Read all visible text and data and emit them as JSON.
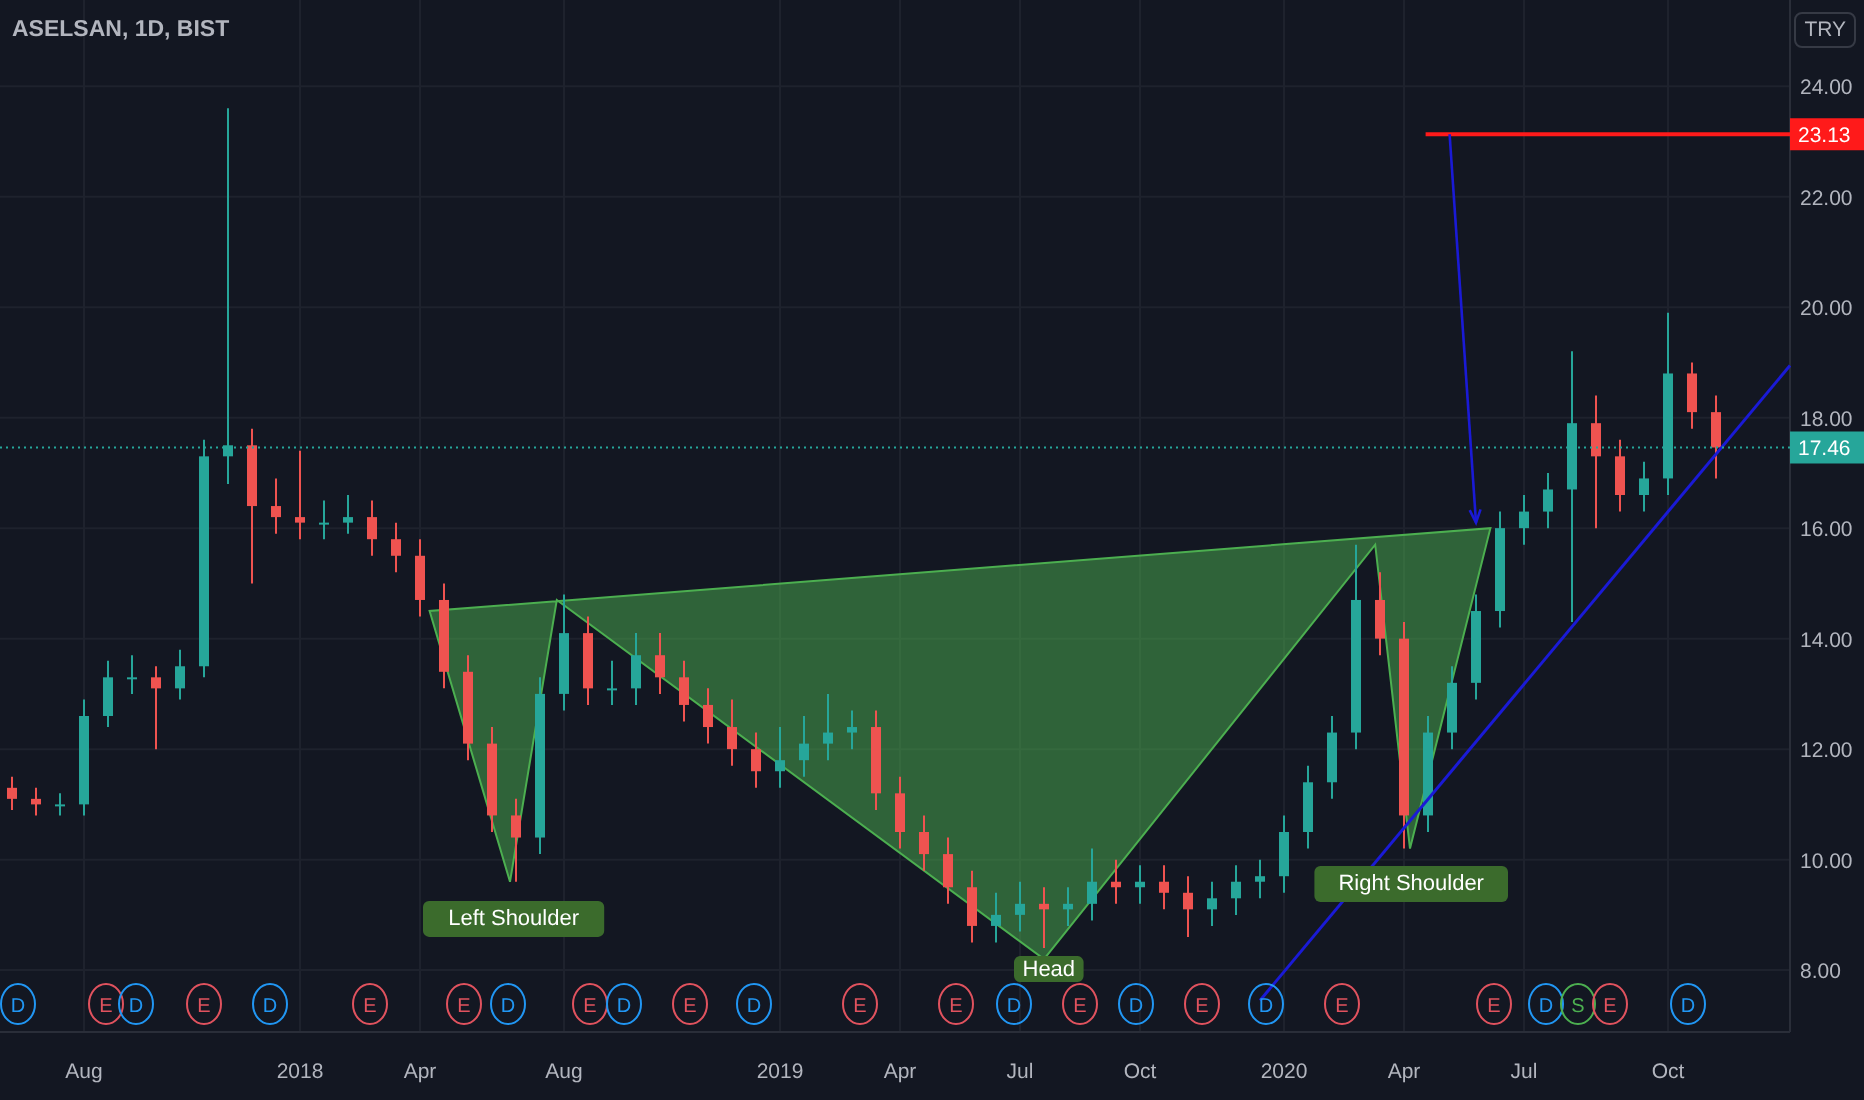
{
  "legend": {
    "title": "ASELSAN, 1D, BIST"
  },
  "currency_button": {
    "label": "TRY"
  },
  "chart": {
    "chart_data": {
      "type": "candlestick",
      "categories": [
        null,
        null,
        null,
        "Aug",
        null,
        null,
        null,
        null,
        null,
        null,
        null,
        null,
        "2018",
        null,
        null,
        null,
        null,
        "Apr",
        null,
        null,
        null,
        null,
        null,
        "Aug",
        null,
        null,
        null,
        null,
        null,
        null,
        null,
        null,
        "2019",
        null,
        null,
        null,
        null,
        "Apr",
        null,
        null,
        null,
        null,
        "Jul",
        null,
        null,
        null,
        null,
        "Oct",
        null,
        null,
        null,
        null,
        null,
        "2020",
        null,
        null,
        null,
        null,
        "Apr",
        null,
        null,
        null,
        null,
        "Jul",
        null,
        null,
        null,
        null,
        null,
        "Oct",
        null,
        null
      ],
      "ohlc": [
        [
          11.3,
          11.5,
          10.9,
          11.1
        ],
        [
          11.1,
          11.3,
          10.8,
          11.0
        ],
        [
          11.0,
          11.2,
          10.8,
          11.0
        ],
        [
          11.0,
          12.9,
          10.8,
          12.6
        ],
        [
          12.6,
          13.6,
          12.4,
          13.3
        ],
        [
          13.3,
          13.7,
          13.0,
          13.3
        ],
        [
          13.3,
          13.5,
          12.0,
          13.1
        ],
        [
          13.1,
          13.8,
          12.9,
          13.5
        ],
        [
          13.5,
          17.6,
          13.3,
          17.3
        ],
        [
          17.3,
          23.6,
          16.8,
          17.5
        ],
        [
          17.5,
          17.8,
          15.0,
          16.4
        ],
        [
          16.4,
          16.9,
          15.9,
          16.2
        ],
        [
          16.2,
          17.4,
          15.8,
          16.1
        ],
        [
          16.1,
          16.5,
          15.8,
          16.1
        ],
        [
          16.1,
          16.6,
          15.9,
          16.2
        ],
        [
          16.2,
          16.5,
          15.5,
          15.8
        ],
        [
          15.8,
          16.1,
          15.2,
          15.5
        ],
        [
          15.5,
          15.8,
          14.4,
          14.7
        ],
        [
          14.7,
          15.0,
          13.1,
          13.4
        ],
        [
          13.4,
          13.7,
          11.8,
          12.1
        ],
        [
          12.1,
          12.4,
          10.5,
          10.8
        ],
        [
          10.8,
          11.1,
          9.6,
          10.4
        ],
        [
          10.4,
          13.3,
          10.1,
          13.0
        ],
        [
          13.0,
          14.8,
          12.7,
          14.1
        ],
        [
          14.1,
          14.4,
          12.8,
          13.1
        ],
        [
          13.1,
          13.6,
          12.8,
          13.1
        ],
        [
          13.1,
          14.1,
          12.8,
          13.7
        ],
        [
          13.7,
          14.1,
          13.0,
          13.3
        ],
        [
          13.3,
          13.6,
          12.5,
          12.8
        ],
        [
          12.8,
          13.1,
          12.1,
          12.4
        ],
        [
          12.4,
          12.9,
          11.7,
          12.0
        ],
        [
          12.0,
          12.3,
          11.3,
          11.6
        ],
        [
          11.6,
          12.4,
          11.3,
          11.8
        ],
        [
          11.8,
          12.6,
          11.5,
          12.1
        ],
        [
          12.1,
          13.0,
          11.8,
          12.3
        ],
        [
          12.3,
          12.7,
          12.0,
          12.4
        ],
        [
          12.4,
          12.7,
          10.9,
          11.2
        ],
        [
          11.2,
          11.5,
          10.2,
          10.5
        ],
        [
          10.5,
          10.8,
          9.8,
          10.1
        ],
        [
          10.1,
          10.4,
          9.2,
          9.5
        ],
        [
          9.5,
          9.8,
          8.5,
          8.8
        ],
        [
          8.8,
          9.4,
          8.5,
          9.0
        ],
        [
          9.0,
          9.6,
          8.7,
          9.2
        ],
        [
          9.2,
          9.5,
          8.4,
          9.1
        ],
        [
          9.1,
          9.5,
          8.8,
          9.2
        ],
        [
          9.2,
          10.2,
          8.9,
          9.6
        ],
        [
          9.6,
          10.0,
          9.2,
          9.5
        ],
        [
          9.5,
          9.9,
          9.2,
          9.6
        ],
        [
          9.6,
          9.9,
          9.1,
          9.4
        ],
        [
          9.4,
          9.7,
          8.6,
          9.1
        ],
        [
          9.1,
          9.6,
          8.8,
          9.3
        ],
        [
          9.3,
          9.9,
          9.0,
          9.6
        ],
        [
          9.6,
          10.0,
          9.3,
          9.7
        ],
        [
          9.7,
          10.8,
          9.4,
          10.5
        ],
        [
          10.5,
          11.7,
          10.2,
          11.4
        ],
        [
          11.4,
          12.6,
          11.1,
          12.3
        ],
        [
          12.3,
          15.7,
          12.0,
          14.7
        ],
        [
          14.7,
          15.2,
          13.7,
          14.0
        ],
        [
          14.0,
          14.3,
          10.2,
          10.8
        ],
        [
          10.8,
          12.6,
          10.5,
          12.3
        ],
        [
          12.3,
          13.5,
          12.0,
          13.2
        ],
        [
          13.2,
          14.8,
          12.9,
          14.5
        ],
        [
          14.5,
          16.3,
          14.2,
          16.0
        ],
        [
          16.0,
          16.6,
          15.7,
          16.3
        ],
        [
          16.3,
          17.0,
          16.0,
          16.7
        ],
        [
          16.7,
          19.2,
          14.3,
          17.9
        ],
        [
          17.9,
          18.4,
          16.0,
          17.3
        ],
        [
          17.3,
          17.6,
          16.3,
          16.6
        ],
        [
          16.6,
          17.2,
          16.3,
          16.9
        ],
        [
          16.9,
          19.9,
          16.6,
          18.8
        ],
        [
          18.8,
          19.0,
          17.8,
          18.1
        ],
        [
          18.1,
          18.4,
          16.9,
          17.46
        ]
      ],
      "ylim": [
        6.88,
        25.56
      ],
      "yticks": [
        {
          "value": 8,
          "label": "8.00"
        },
        {
          "value": 10,
          "label": "10.00"
        },
        {
          "value": 12,
          "label": "12.00"
        },
        {
          "value": 14,
          "label": "14.00"
        },
        {
          "value": 16,
          "label": "16.00"
        },
        {
          "value": 18,
          "label": "18.00"
        },
        {
          "value": 20,
          "label": "20.00"
        },
        {
          "value": 22,
          "label": "22.00"
        },
        {
          "value": 24,
          "label": "24.00"
        }
      ],
      "grid": true,
      "ref_lines": [
        {
          "axis": "y",
          "value": 23.13,
          "label": "23.13",
          "color": "#ff1a1a"
        },
        {
          "axis": "y",
          "value": 17.46,
          "label": "17.46",
          "color": "#26a69a"
        }
      ],
      "annotations": [
        "Left Shoulder",
        "Head",
        "Right Shoulder"
      ]
    }
  },
  "events": [
    {
      "letter": "D",
      "color": "#2196f3"
    },
    {
      "letter": "E",
      "color": "#e0525e"
    },
    {
      "letter": "D",
      "color": "#2196f3"
    },
    {
      "letter": "E",
      "color": "#e0525e"
    },
    {
      "letter": "D",
      "color": "#2196f3"
    },
    {
      "letter": "E",
      "color": "#e0525e"
    },
    {
      "letter": "E",
      "color": "#e0525e"
    },
    {
      "letter": "D",
      "color": "#2196f3"
    },
    {
      "letter": "E",
      "color": "#e0525e"
    },
    {
      "letter": "D",
      "color": "#2196f3"
    },
    {
      "letter": "E",
      "color": "#e0525e"
    },
    {
      "letter": "D",
      "color": "#2196f3"
    },
    {
      "letter": "E",
      "color": "#e0525e"
    },
    {
      "letter": "E",
      "color": "#e0525e"
    },
    {
      "letter": "D",
      "color": "#2196f3"
    },
    {
      "letter": "E",
      "color": "#e0525e"
    },
    {
      "letter": "D",
      "color": "#2196f3"
    },
    {
      "letter": "E",
      "color": "#e0525e"
    },
    {
      "letter": "D",
      "color": "#2196f3"
    },
    {
      "letter": "E",
      "color": "#e0525e"
    },
    {
      "letter": "E",
      "color": "#e0525e"
    },
    {
      "letter": "D",
      "color": "#2196f3"
    },
    {
      "letter": "S",
      "color": "#4caf50"
    },
    {
      "letter": "E",
      "color": "#e0525e"
    },
    {
      "letter": "D",
      "color": "#2196f3"
    }
  ]
}
